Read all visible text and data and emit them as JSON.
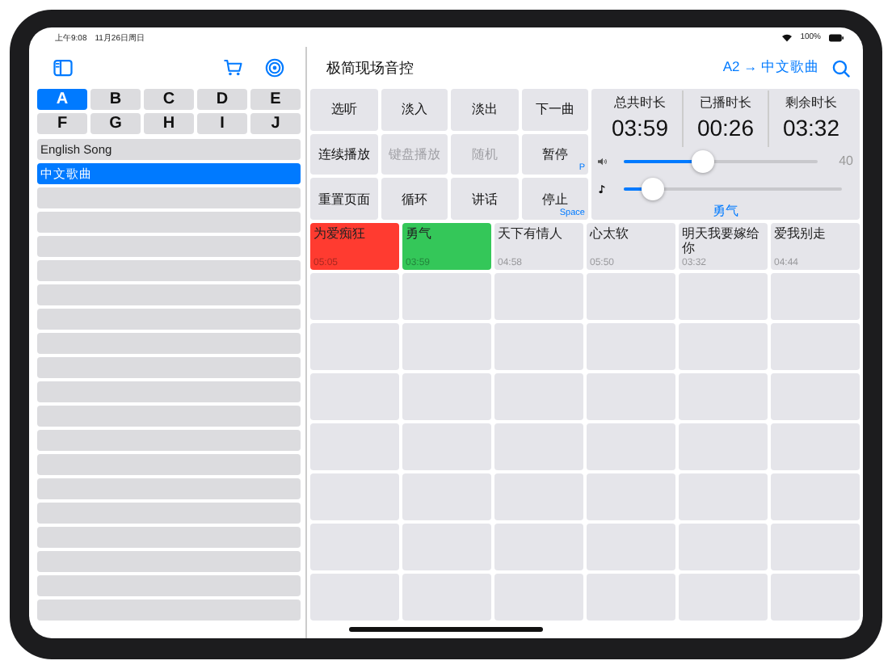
{
  "status_bar": {
    "time": "上午9:08",
    "date": "11月26日周日",
    "battery": "100%"
  },
  "sidebar": {
    "letter_tabs": [
      {
        "label": "A",
        "selected": true
      },
      {
        "label": "B",
        "selected": false
      },
      {
        "label": "C",
        "selected": false
      },
      {
        "label": "D",
        "selected": false
      },
      {
        "label": "E",
        "selected": false
      },
      {
        "label": "F",
        "selected": false
      },
      {
        "label": "G",
        "selected": false
      },
      {
        "label": "H",
        "selected": false
      },
      {
        "label": "I",
        "selected": false
      },
      {
        "label": "J",
        "selected": false
      }
    ],
    "items": [
      {
        "label": "English Song",
        "selected": false
      },
      {
        "label": "中文歌曲",
        "selected": true
      }
    ]
  },
  "header": {
    "title": "极简现场音控",
    "breadcrumb": "A2 → 中文歌曲"
  },
  "controls": [
    {
      "label": "选听",
      "disabled": false
    },
    {
      "label": "淡入",
      "disabled": false
    },
    {
      "label": "淡出",
      "disabled": false
    },
    {
      "label": "下一曲",
      "disabled": false
    },
    {
      "label": "连续播放",
      "disabled": false
    },
    {
      "label": "键盘播放",
      "disabled": true
    },
    {
      "label": "随机",
      "disabled": true
    },
    {
      "label": "暂停",
      "disabled": false,
      "hotkey": "P"
    },
    {
      "label": "重置页面",
      "disabled": false
    },
    {
      "label": "循环",
      "disabled": false
    },
    {
      "label": "讲话",
      "disabled": false
    },
    {
      "label": "停止",
      "disabled": false,
      "hotkey": "Space"
    }
  ],
  "timers": [
    {
      "label": "总共时长",
      "value": "03:59"
    },
    {
      "label": "已播时长",
      "value": "00:26"
    },
    {
      "label": "剩余时长",
      "value": "03:32"
    }
  ],
  "volume": {
    "level": 0.41,
    "reading": "40"
  },
  "pitch": {
    "level": 0.13,
    "label": "勇气"
  },
  "songs": [
    {
      "title": "为爱痴狂",
      "duration": "05:05",
      "color": "#ff3b30"
    },
    {
      "title": "勇气",
      "duration": "03:59",
      "color": "#34c759"
    },
    {
      "title": "天下有情人",
      "duration": "04:58",
      "color": "#e5e5ea"
    },
    {
      "title": "心太软",
      "duration": "05:50",
      "color": "#e5e5ea"
    },
    {
      "title": "明天我要嫁给你",
      "duration": "03:32",
      "color": "#e5e5ea"
    },
    {
      "title": "爱我别走",
      "duration": "04:44",
      "color": "#e5e5ea"
    }
  ]
}
